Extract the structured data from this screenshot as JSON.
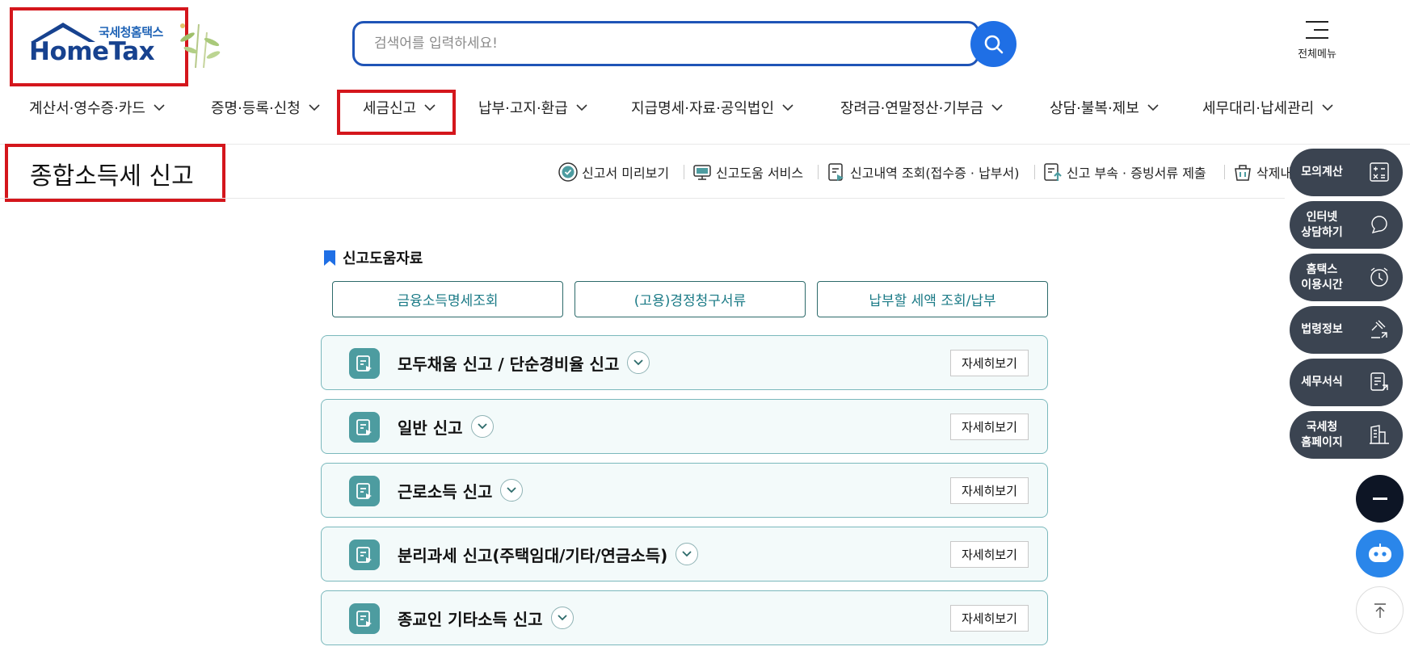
{
  "header": {
    "logo_small": "국세청홈택스",
    "logo_big": "HomeTax",
    "search_placeholder": "검색어를 입력하세요!",
    "all_menu_label": "전체메뉴"
  },
  "nav": {
    "items": [
      {
        "label": "계산서·영수증·카드"
      },
      {
        "label": "증명·등록·신청"
      },
      {
        "label": "세금신고"
      },
      {
        "label": "납부·고지·환급"
      },
      {
        "label": "지급명세·자료·공익법인"
      },
      {
        "label": "장려금·연말정산·기부금"
      },
      {
        "label": "상담·불복·제보"
      },
      {
        "label": "세무대리·납세관리"
      }
    ]
  },
  "page": {
    "title": "종합소득세 신고",
    "quick_links": [
      {
        "label": "신고서 미리보기",
        "icon": "check-circle-icon"
      },
      {
        "label": "신고도움 서비스",
        "icon": "monitor-help-icon"
      },
      {
        "label": "신고내역 조회(접수증 · 납부서)",
        "icon": "document-search-icon"
      },
      {
        "label": "신고 부속 · 증빙서류 제출",
        "icon": "document-upload-icon"
      },
      {
        "label": "삭제내",
        "icon": "trash-icon"
      }
    ]
  },
  "help": {
    "title": "신고도움자료",
    "buttons": [
      {
        "label": "금융소득명세조회"
      },
      {
        "label": "(고용)경정청구서류"
      },
      {
        "label": "납부할 세액 조회/납부"
      }
    ]
  },
  "accordions": [
    {
      "label": "모두채움 신고 / 단순경비율 신고",
      "more": "자세히보기"
    },
    {
      "label": "일반 신고",
      "more": "자세히보기"
    },
    {
      "label": "근로소득 신고",
      "more": "자세히보기"
    },
    {
      "label": "분리과세 신고(주택임대/기타/연금소득)",
      "more": "자세히보기"
    },
    {
      "label": "종교인 기타소득 신고",
      "more": "자세히보기"
    }
  ],
  "float_menu": [
    {
      "label": "모의계산",
      "icon": "calculator-icon"
    },
    {
      "label": "인터넷\n상담하기",
      "icon": "chat-icon"
    },
    {
      "label": "홈택스\n이용시간",
      "icon": "clock-icon"
    },
    {
      "label": "법령정보",
      "icon": "gavel-icon"
    },
    {
      "label": "세무서식",
      "icon": "form-icon"
    },
    {
      "label": "국세청\n홈페이지",
      "icon": "building-icon"
    }
  ],
  "colors": {
    "brand": "#1f54b7",
    "highlight": "#d4161c",
    "teal": "#4d9ca0",
    "float_bg": "#3b4451"
  }
}
